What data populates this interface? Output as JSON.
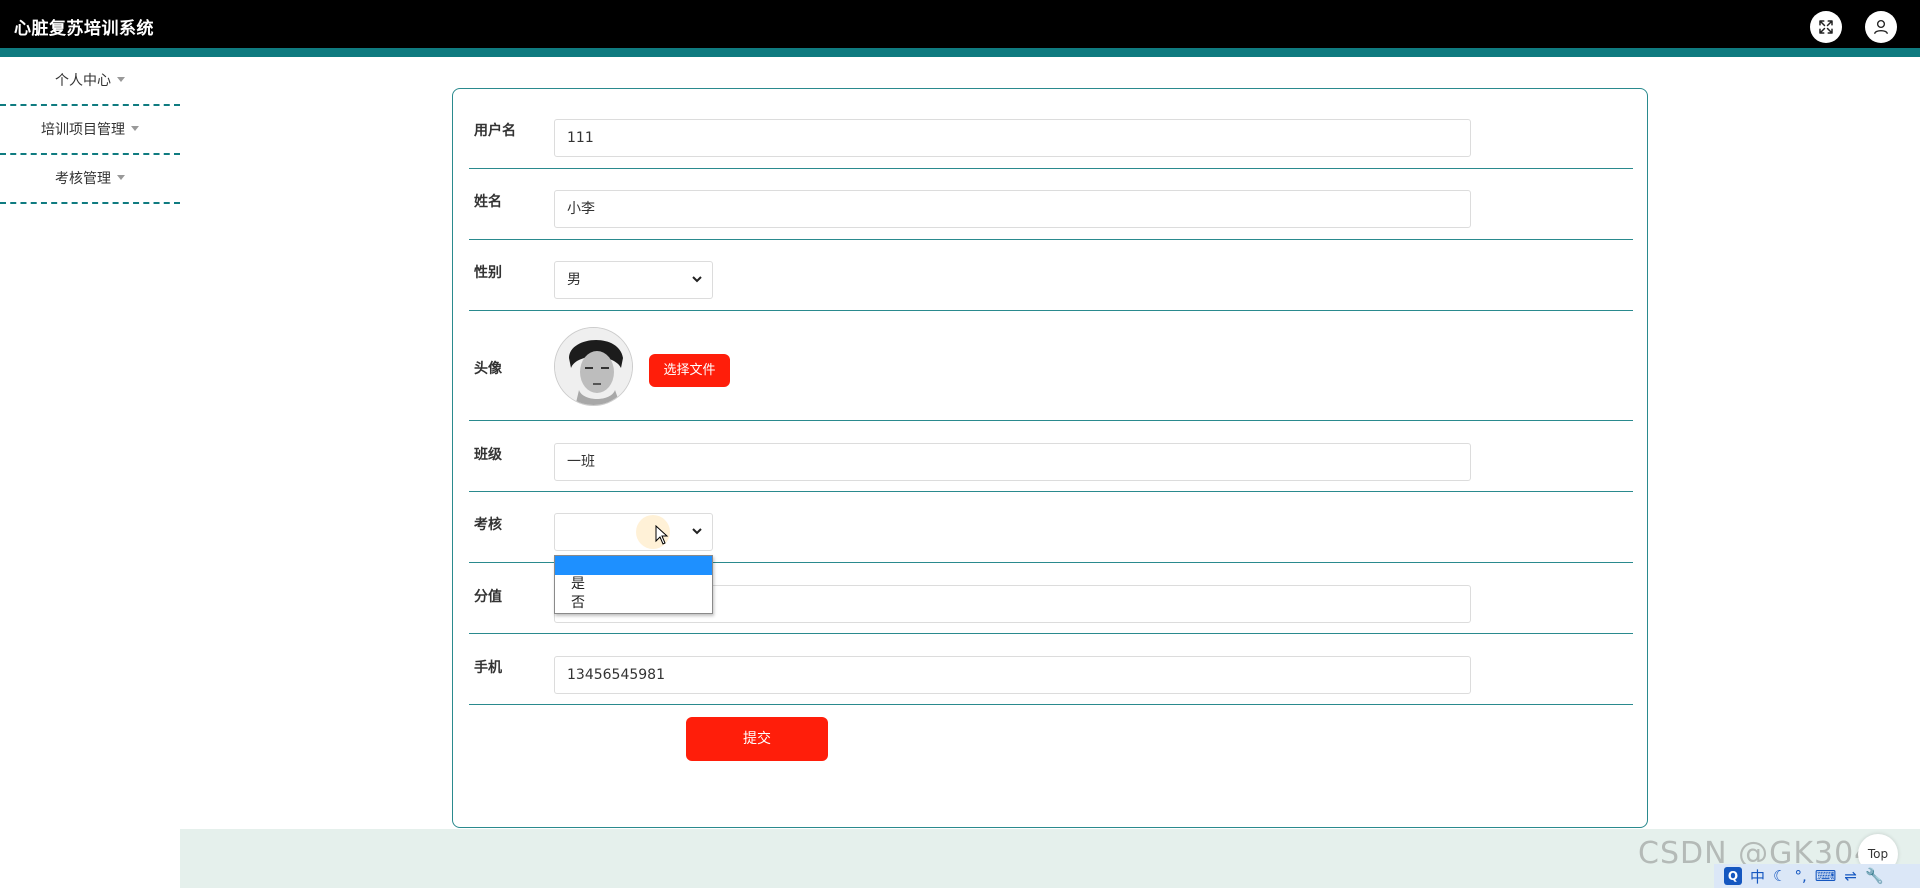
{
  "app": {
    "title": "心脏复苏培训系统"
  },
  "header": {
    "fullscreen_icon": "expand-icon",
    "user_icon": "user-icon"
  },
  "sidebar": {
    "items": [
      {
        "label": "个人中心"
      },
      {
        "label": "培训项目管理"
      },
      {
        "label": "考核管理"
      }
    ]
  },
  "form": {
    "username": {
      "label": "用户名",
      "value": "111"
    },
    "name": {
      "label": "姓名",
      "value": "小李"
    },
    "gender": {
      "label": "性别",
      "value": "男"
    },
    "avatar": {
      "label": "头像",
      "button": "选择文件"
    },
    "class": {
      "label": "班级",
      "value": "一班"
    },
    "exam": {
      "label": "考核",
      "value": "",
      "options": [
        "",
        "是",
        "否"
      ]
    },
    "score": {
      "label": "分值",
      "value": ""
    },
    "phone": {
      "label": "手机",
      "value": "13456545981"
    },
    "submit": "提交"
  },
  "overlay": {
    "watermark": "CSDN @GK3041",
    "top_button": "Top",
    "tray": {
      "ime": "Q",
      "lang": "中",
      "moon": "☾",
      "punct": "°,",
      "keyboard": "⌨",
      "misc1": "⇌",
      "misc2": "🔧"
    }
  },
  "colors": {
    "accent": "#0f7b80",
    "primary_button": "#ff1e0a",
    "selected_option": "#1e90ff"
  }
}
